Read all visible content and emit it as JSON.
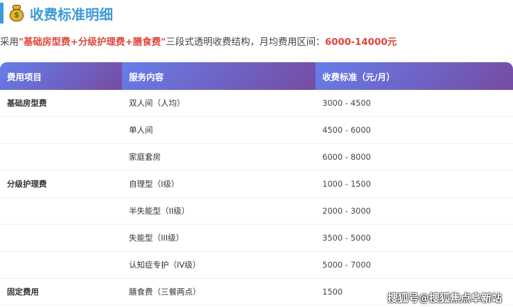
{
  "title": "收费标准明细",
  "subtitle": {
    "prefix": "采用",
    "quote_open": "\"",
    "highlight": "基础房型费+分级护理费+膳食费",
    "quote_close": "\"",
    "middle": "三段式透明收费结构，月均费用区间：",
    "range": "6000-14000元"
  },
  "table": {
    "headers": [
      "费用项目",
      "服务内容",
      "收费标准（元/月）"
    ],
    "rows": [
      {
        "item": "基础房型费",
        "service": "双人间（人均）",
        "price": "3000 - 4500"
      },
      {
        "item": "",
        "service": "单人间",
        "price": "4500 - 6000"
      },
      {
        "item": "",
        "service": "家庭套房",
        "price": "6000 - 8000"
      },
      {
        "item": "分级护理费",
        "service": "自理型（I级）",
        "price": "1000 - 1500"
      },
      {
        "item": "",
        "service": "半失能型（II级）",
        "price": "2000 - 3000"
      },
      {
        "item": "",
        "service": "失能型（III级）",
        "price": "3500 - 5000"
      },
      {
        "item": "",
        "service": "认知症专护（IV级）",
        "price": "5000 - 7000"
      },
      {
        "item": "固定费用",
        "service": "膳食费（三餐两点）",
        "price": "1500"
      }
    ]
  },
  "watermark": "搜狐号@搜狐焦点阜新站",
  "colors": {
    "accent": "#3a9ad9",
    "highlight": "#e0463a",
    "header_start": "#667eea",
    "header_end": "#764ba2"
  }
}
